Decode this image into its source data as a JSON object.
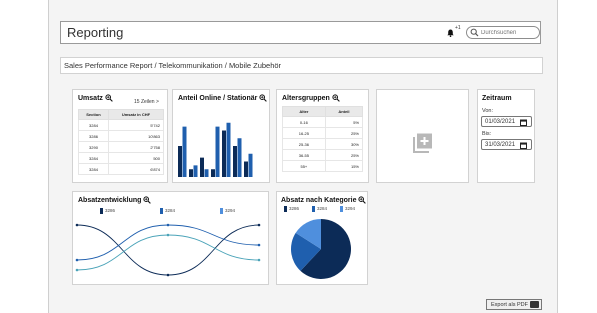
{
  "header": {
    "title": "Reporting",
    "notification_count": "+1",
    "search_placeholder": "Durchsuchen"
  },
  "breadcrumb": "Sales Performance Report / Telekommunikation / Mobile Zubehör",
  "umsatz": {
    "title": "Umsatz",
    "rows_label": "15 Zeilen",
    "columns": [
      "Section",
      "Umsatz in CHF"
    ],
    "rows": [
      [
        "3284",
        "5'742"
      ],
      [
        "3286",
        "10'863"
      ],
      [
        "3290",
        "2'758"
      ],
      [
        "3284",
        "500"
      ],
      [
        "3284",
        "6'874"
      ]
    ]
  },
  "anteil": {
    "title": "Anteil Online / Stationär"
  },
  "alter": {
    "title": "Altersgruppen",
    "columns": [
      "Alter",
      "Anteil"
    ],
    "rows": [
      [
        "0-16",
        "5%"
      ],
      [
        "16-25",
        "25%"
      ],
      [
        "25-36",
        "30%"
      ],
      [
        "36-55",
        "25%"
      ],
      [
        "55+",
        "15%"
      ]
    ]
  },
  "zeitraum": {
    "title": "Zeitraum",
    "von_label": "Von:",
    "von_value": "01/03/2021",
    "bis_label": "Bis:",
    "bis_value": "31/03/2021"
  },
  "absatzentwicklung": {
    "title": "Absatzentwicklung",
    "legend": [
      "3286",
      "3284",
      "3294"
    ]
  },
  "kategorie": {
    "title": "Absatz nach Kategorie",
    "legend": [
      "3286",
      "3284",
      "3294"
    ]
  },
  "export_label": "Export als PDF",
  "colors": {
    "dark": "#0c2b57",
    "mid": "#1f5fae",
    "light": "#4f8fdd",
    "teal": "#4aa3b8"
  },
  "chart_data": [
    {
      "type": "bar",
      "panel": "Anteil Online / Stationär",
      "series": [
        {
          "values": [
            4,
            1,
            2.5,
            1,
            6,
            4,
            2
          ]
        },
        {
          "values": [
            6.5,
            1.5,
            1,
            6.5,
            7,
            5,
            3
          ]
        }
      ],
      "ylim": [
        0,
        8
      ]
    },
    {
      "type": "line",
      "panel": "Absatzentwicklung",
      "x": [
        0,
        1,
        2
      ],
      "series": [
        {
          "name": "3286",
          "values": [
            1,
            0,
            1
          ]
        },
        {
          "name": "3284",
          "values": [
            0.3,
            1,
            0.6
          ]
        },
        {
          "name": "3294",
          "values": [
            0.1,
            0.8,
            0.3
          ]
        }
      ],
      "ylim": [
        0,
        1
      ]
    },
    {
      "type": "pie",
      "panel": "Absatz nach Kategorie",
      "categories": [
        "3286",
        "3284",
        "3294"
      ],
      "values": [
        62,
        22,
        16
      ]
    }
  ]
}
